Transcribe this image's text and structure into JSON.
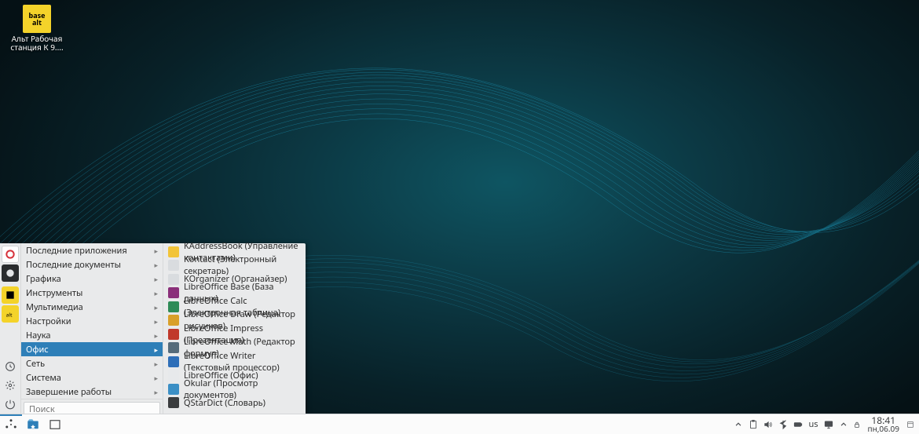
{
  "desktop_icon": {
    "label": "Альт Рабочая станция К 9....",
    "glyph_text": "base\nalt"
  },
  "menu": {
    "categories": [
      {
        "label": "Последние приложения",
        "has_sub": true
      },
      {
        "label": "Последние документы",
        "has_sub": true
      },
      {
        "label": "Графика",
        "has_sub": true
      },
      {
        "label": "Инструменты",
        "has_sub": true
      },
      {
        "label": "Мультимедиа",
        "has_sub": true
      },
      {
        "label": "Настройки",
        "has_sub": true
      },
      {
        "label": "Наука",
        "has_sub": true
      },
      {
        "label": "Офис",
        "has_sub": true,
        "selected": true
      },
      {
        "label": "Сеть",
        "has_sub": true
      },
      {
        "label": "Система",
        "has_sub": true
      },
      {
        "label": "Завершение работы",
        "has_sub": true
      }
    ],
    "apps": [
      {
        "label": "KAddressBook (Управление контактами)",
        "color": "#f2c438"
      },
      {
        "label": "Kontact (Электронный секретарь)",
        "color": "#d9dcdf"
      },
      {
        "label": "KOrganizer (Органайзер)",
        "color": "#d9dcdf"
      },
      {
        "label": "LibreOffice Base (База данных)",
        "color": "#8a2f7a"
      },
      {
        "label": "LibreOffice Calc (Электронная таблица)",
        "color": "#2e8b57"
      },
      {
        "label": "LibreOffice Draw (Редактор рисунков)",
        "color": "#d9a02a"
      },
      {
        "label": "LibreOffice Impress (Презентация)",
        "color": "#c0392b"
      },
      {
        "label": "LibreOffice Math (Редактор формул)",
        "color": "#556b7a"
      },
      {
        "label": "LibreOffice Writer (Текстовый процессор)",
        "color": "#2e6fb8"
      },
      {
        "label": "LibreOffice (Офис)",
        "color": "#e7e9eb"
      },
      {
        "label": "Okular (Просмотр документов)",
        "color": "#3b8fc5"
      },
      {
        "label": "QStarDict (Словарь)",
        "color": "#3a3c3e"
      }
    ],
    "search_placeholder": "Поиск"
  },
  "taskbar": {
    "keyboard_layout": "us",
    "clock_time": "18:41",
    "clock_date": "пн,06.09"
  }
}
